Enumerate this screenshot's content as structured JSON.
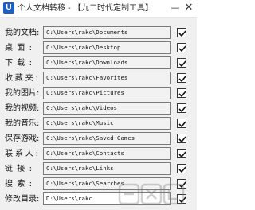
{
  "window": {
    "title": "个人文档转移 - 【九二时代定制工具】",
    "minimize_glyph": "—",
    "close_glyph": "✕",
    "icon_glyph": "U"
  },
  "rows": [
    {
      "label": "我的文档:",
      "path": "C:\\Users\\rakc\\Documents",
      "checked": true
    },
    {
      "label": "桌面:",
      "path": "C:\\Users\\rakc\\Desktop",
      "checked": true
    },
    {
      "label": "下载:",
      "path": "C:\\Users\\rakc\\Downloads",
      "checked": true
    },
    {
      "label": "收藏夹:",
      "path": "C:\\Users\\rakc\\Favorites",
      "checked": true
    },
    {
      "label": "我的图片:",
      "path": "C:\\Users\\rakc\\Pictures",
      "checked": true
    },
    {
      "label": "我的视频:",
      "path": "C:\\Users\\rakc\\Videos",
      "checked": true
    },
    {
      "label": "我的音乐:",
      "path": "C:\\Users\\rakc\\Music",
      "checked": true
    },
    {
      "label": "保存游戏:",
      "path": "C:\\Users\\rakc\\Saved Games",
      "checked": true
    },
    {
      "label": "联系人:",
      "path": "C:\\Users\\rakc\\Contacts",
      "checked": true
    },
    {
      "label": "链接:",
      "path": "C:\\Users\\rakc\\Links",
      "checked": true
    },
    {
      "label": "搜索:",
      "path": "C:\\Users\\rakc\\Searches",
      "checked": true
    },
    {
      "label": "修改目录:",
      "path": "D:\\Users\\rakc",
      "checked": true
    }
  ],
  "watermark_text": "G XI 网"
}
